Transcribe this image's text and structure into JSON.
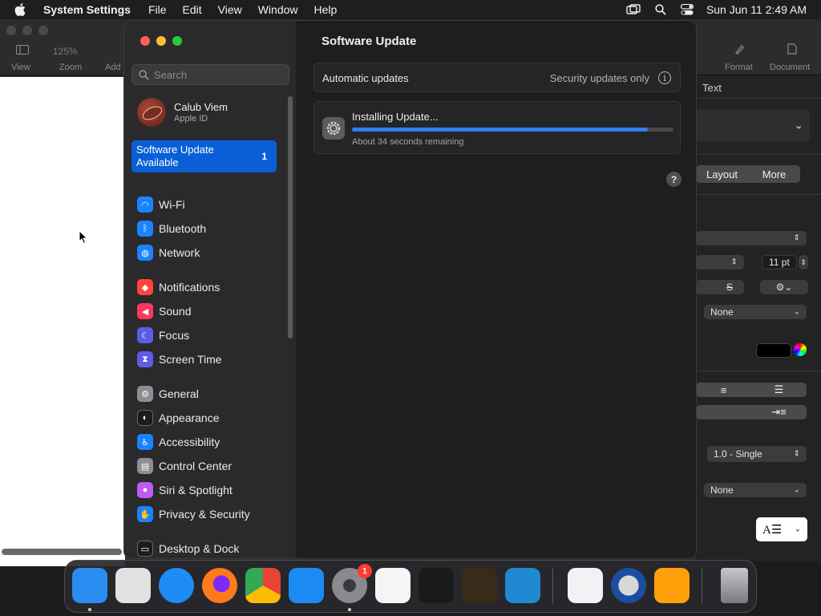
{
  "menubar": {
    "app_name": "System Settings",
    "items": [
      "File",
      "Edit",
      "View",
      "Window",
      "Help"
    ],
    "clock": "Sun Jun 11  2:49 AM"
  },
  "background_app": {
    "toolbar": {
      "zoom_value": "125%",
      "view_label": "View",
      "zoom_label": "Zoom",
      "add_label": "Add",
      "format_label": "Format",
      "document_label": "Document"
    },
    "inspector": {
      "tab_text": "Text",
      "layout_label": "Layout",
      "more_label": "More",
      "font_size": "11 pt",
      "strike_label": "S",
      "none_1": "None",
      "spacing": "1.0 - Single",
      "none_2": "None"
    }
  },
  "settings": {
    "search_placeholder": "Search",
    "account": {
      "name": "Calub Viem",
      "subtitle": "Apple ID"
    },
    "update_item": {
      "label": "Software Update Available",
      "badge": "1"
    },
    "sidebar_items": [
      {
        "label": "Wi-Fi",
        "icon": "wifi-icon",
        "color": "#1a84ff"
      },
      {
        "label": "Bluetooth",
        "icon": "bluetooth-icon",
        "color": "#1a84ff"
      },
      {
        "label": "Network",
        "icon": "globe-icon",
        "color": "#1a84ff"
      },
      {
        "label": "Notifications",
        "icon": "bell-icon",
        "color": "#ff453a"
      },
      {
        "label": "Sound",
        "icon": "speaker-icon",
        "color": "#ff375f"
      },
      {
        "label": "Focus",
        "icon": "moon-icon",
        "color": "#5e5ce6"
      },
      {
        "label": "Screen Time",
        "icon": "hourglass-icon",
        "color": "#5e5ce6"
      },
      {
        "label": "General",
        "icon": "gear-icon",
        "color": "#8e8e93"
      },
      {
        "label": "Appearance",
        "icon": "appearance-icon",
        "color": "#1c1c1e"
      },
      {
        "label": "Accessibility",
        "icon": "accessibility-icon",
        "color": "#1a84ff"
      },
      {
        "label": "Control Center",
        "icon": "control-center-icon",
        "color": "#8e8e93"
      },
      {
        "label": "Siri & Spotlight",
        "icon": "siri-icon",
        "color": "#bf5af2"
      },
      {
        "label": "Privacy & Security",
        "icon": "hand-icon",
        "color": "#1a84ff"
      },
      {
        "label": "Desktop & Dock",
        "icon": "dock-icon",
        "color": "#1c1c1e"
      }
    ],
    "content": {
      "title": "Software Update",
      "automatic_label": "Automatic updates",
      "automatic_value": "Security updates only",
      "installing_label": "Installing Update...",
      "progress": 0.92,
      "remaining": "About 34 seconds remaining"
    }
  },
  "dock": {
    "apps": [
      {
        "name": "finder",
        "color": "#2a8cf0"
      },
      {
        "name": "launchpad",
        "color": "#e2e2e2"
      },
      {
        "name": "safari",
        "color": "#1e8cf5"
      },
      {
        "name": "firefox",
        "color": "#ff7a1a"
      },
      {
        "name": "chrome",
        "color": "#ffffff"
      },
      {
        "name": "app-store",
        "color": "#1c8af5"
      },
      {
        "name": "system-settings",
        "color": "#8a8a8e",
        "badge": "1"
      },
      {
        "name": "textedit",
        "color": "#f5f5f5"
      },
      {
        "name": "terminal",
        "color": "#1a1a1a"
      },
      {
        "name": "garageband",
        "color": "#3a2a1a"
      },
      {
        "name": "vscode",
        "color": "#1f8ad2"
      },
      {
        "name": "visual-studio",
        "color": "#f2f2f4"
      },
      {
        "name": "quicktime",
        "color": "#1a4fa0"
      },
      {
        "name": "pages",
        "color": "#ff9f0a"
      },
      {
        "name": "trash",
        "color": "#9a9a9e"
      }
    ]
  }
}
